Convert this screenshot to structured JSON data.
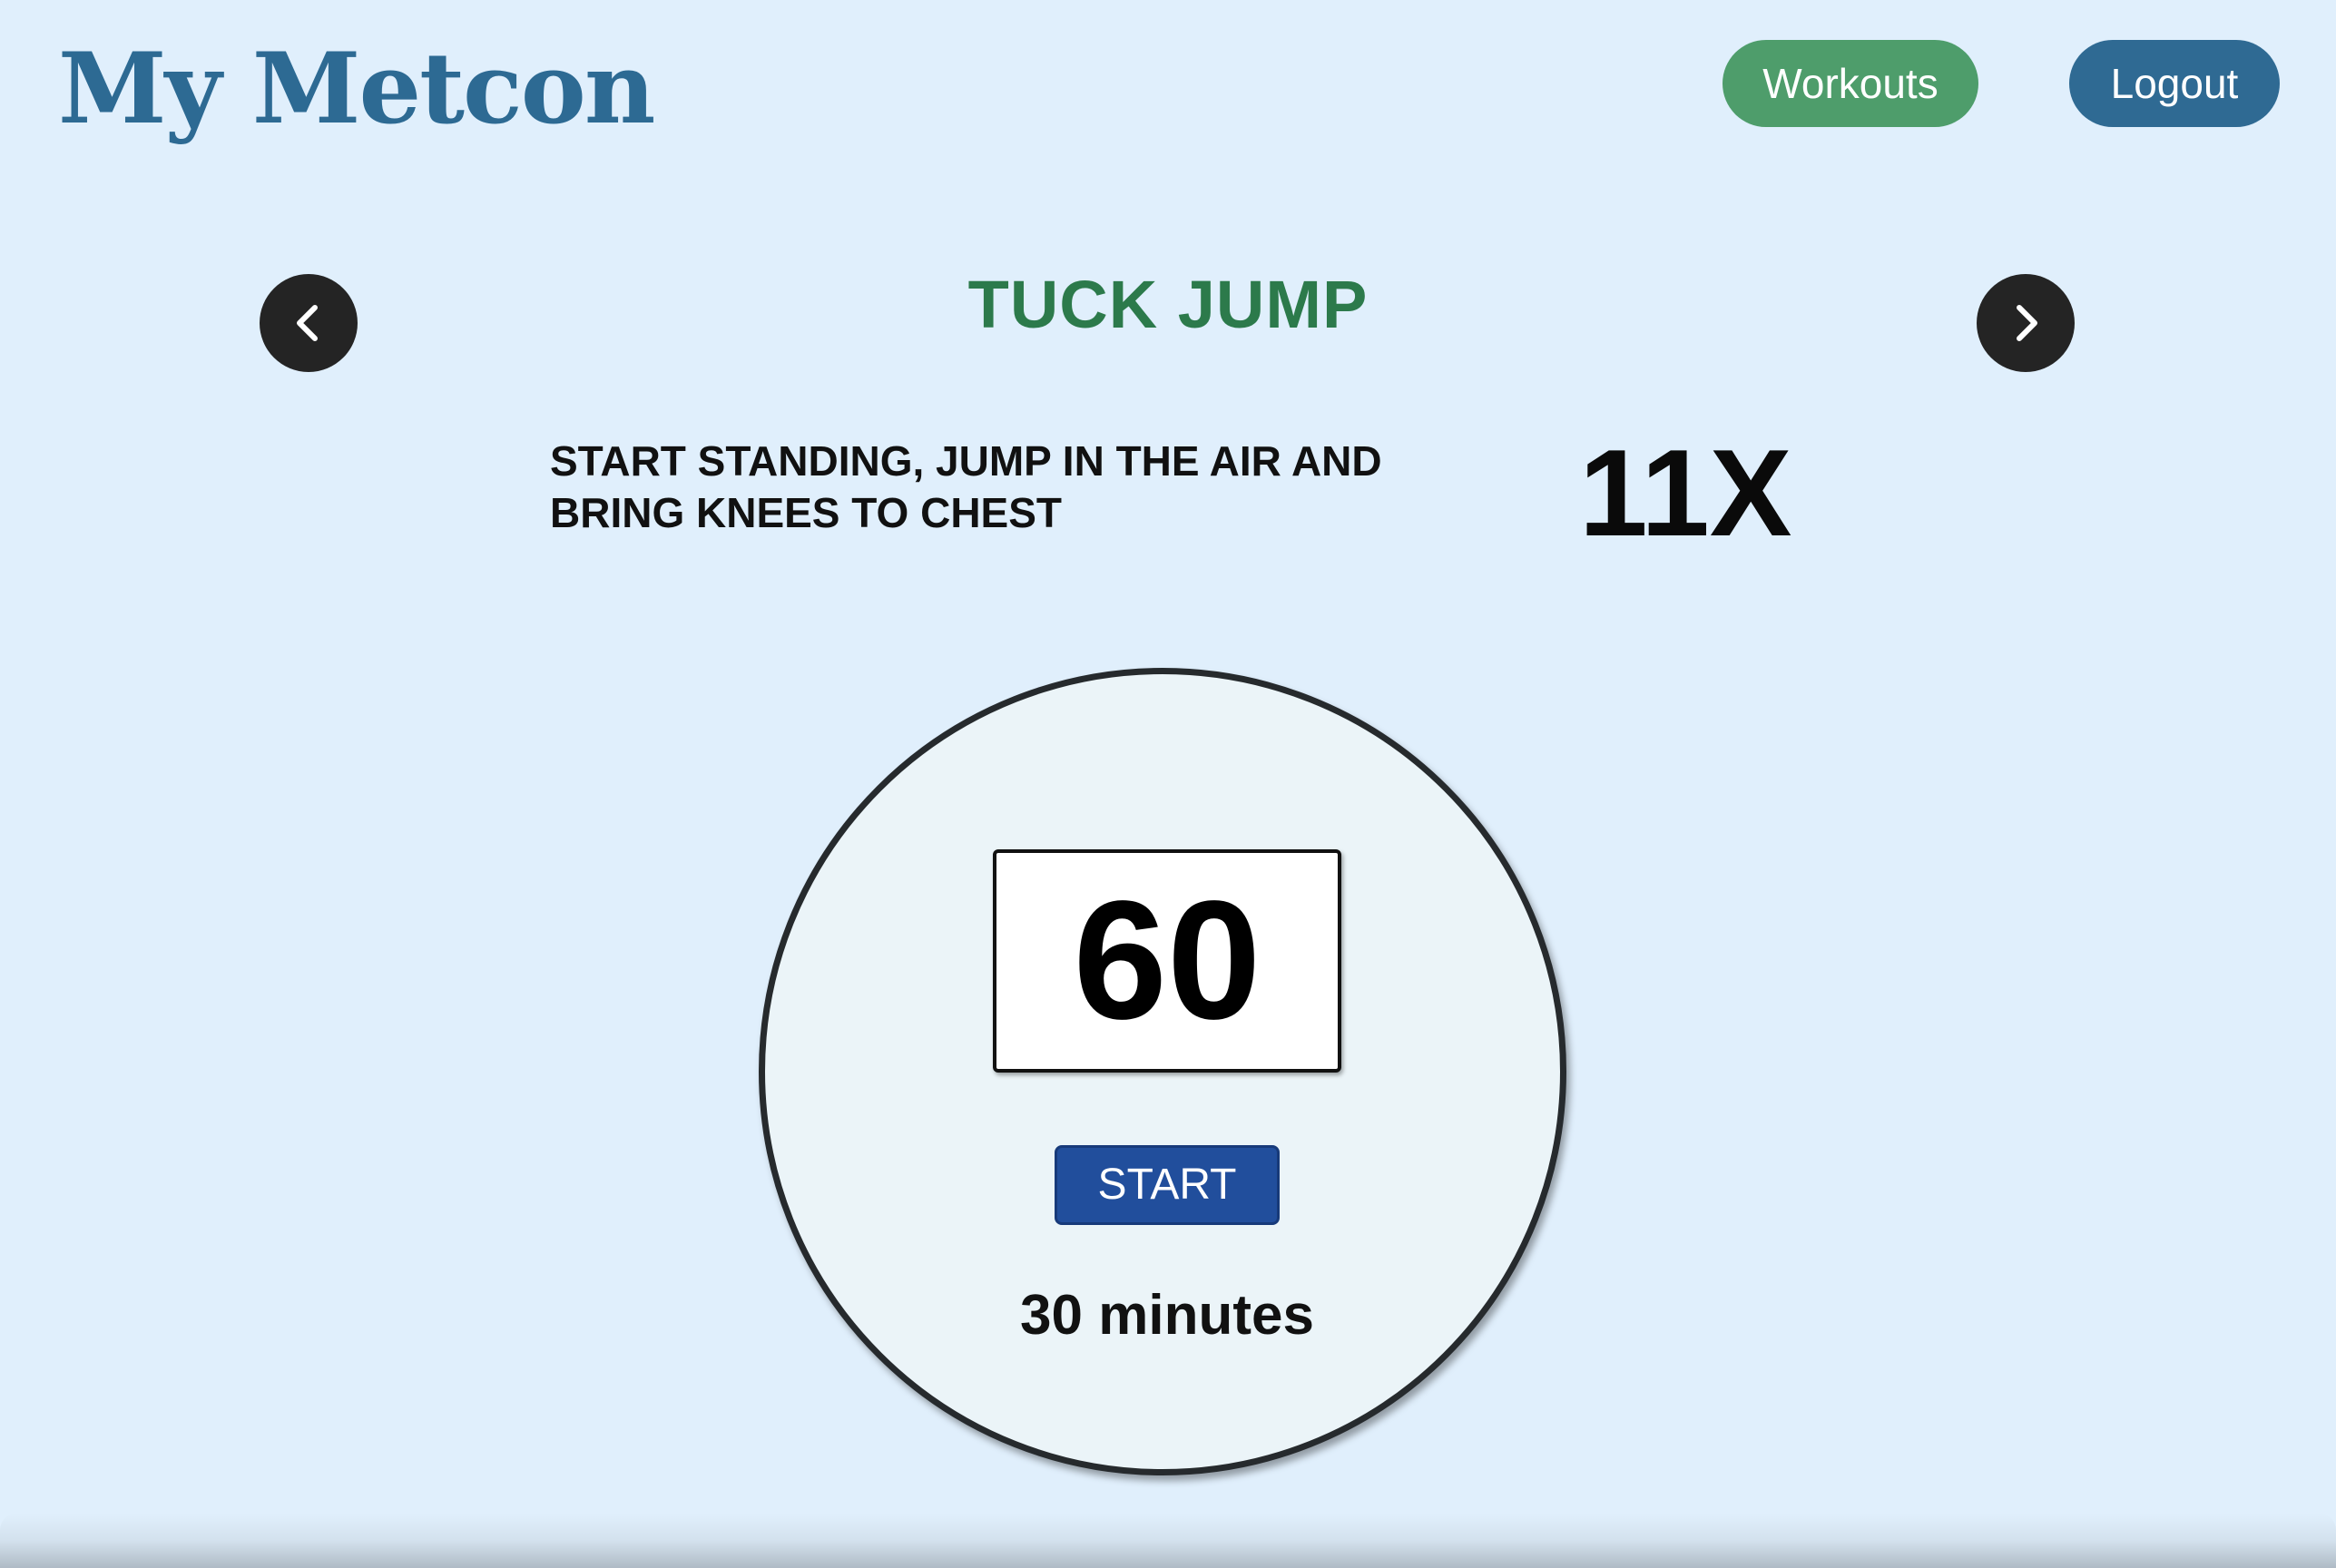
{
  "header": {
    "logo_text": "My Metcon",
    "nav": {
      "workouts_label": "Workouts",
      "logout_label": "Logout"
    }
  },
  "exercise": {
    "name": "TUCK JUMP",
    "description": "START STANDING, JUMP IN THE AIR AND BRING KNEES TO CHEST",
    "reps": "11X"
  },
  "timer": {
    "countdown": "60",
    "start_label": "START",
    "duration": "30 minutes"
  },
  "icons": {
    "prev": "chevron-left-icon",
    "next": "chevron-right-icon"
  },
  "colors": {
    "background": "#e0effc",
    "logo": "#2d6a93",
    "workouts_button": "#4e9d6b",
    "logout_button": "#2f6a93",
    "exercise_title": "#2c7a4b",
    "start_button": "#214e9c"
  }
}
